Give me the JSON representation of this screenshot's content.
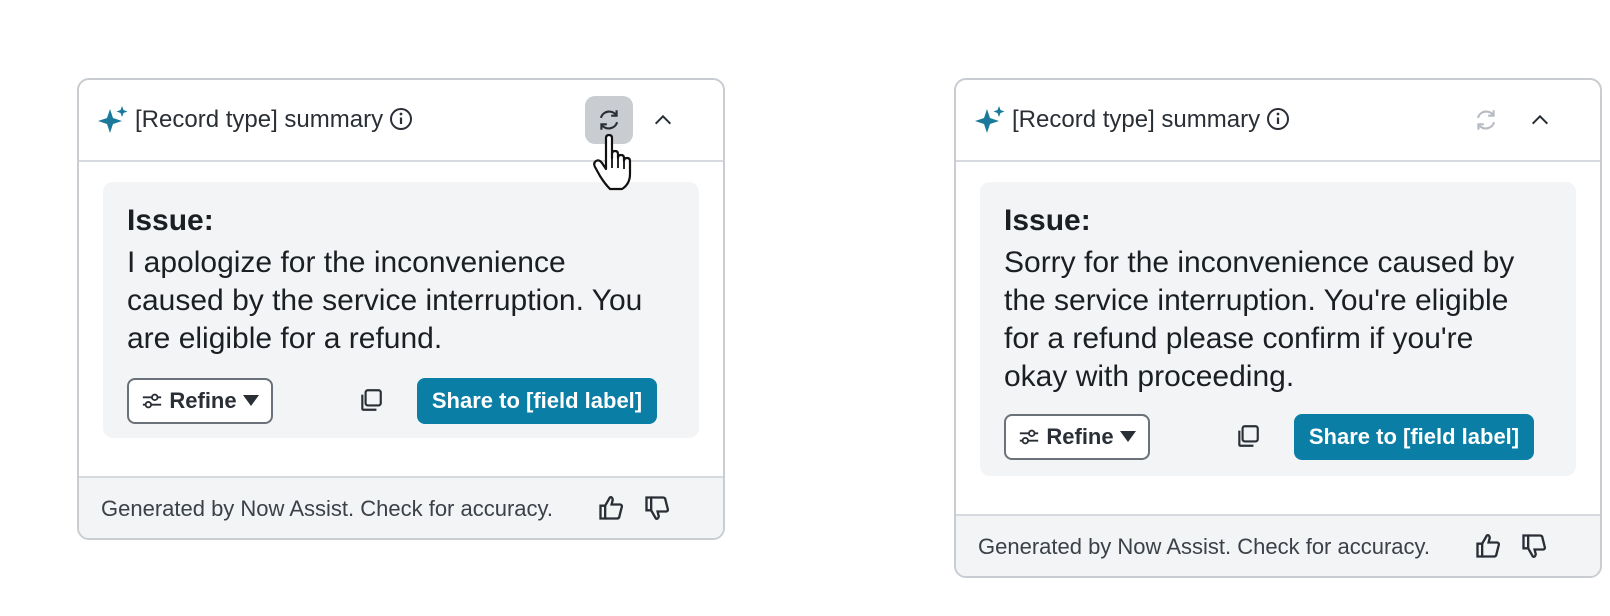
{
  "cards": [
    {
      "title": "[Record type] summary",
      "issue_label": "Issue:",
      "issue_text": "I apologize for the inconvenience caused by the service interruption. You are eligible for a refund.",
      "refine_label": "Refine",
      "share_label": "Share to [field label]",
      "footer_text": "Generated by Now Assist. Check for accuracy.",
      "refresh_state": "hover"
    },
    {
      "title": "[Record type] summary",
      "issue_label": "Issue:",
      "issue_text": "Sorry for the inconvenience caused by the service interruption. You're eligible for a refund please confirm if you're okay with proceeding.",
      "refine_label": "Refine",
      "share_label": "Share to [field label]",
      "footer_text": "Generated by Now Assist. Check for accuracy.",
      "refresh_state": "disabled"
    }
  ],
  "colors": {
    "accent": "#0a7ea4",
    "sparkle": "#1b7a9c",
    "hover_bg": "#c9cdd2",
    "panel_bg": "#f3f4f6"
  },
  "icons": [
    "sparkle-icon",
    "info-icon",
    "refresh-icon",
    "chevron-up-icon",
    "sliders-icon",
    "caret-down-icon",
    "copy-icon",
    "thumbs-up-icon",
    "thumbs-down-icon",
    "pointer-cursor"
  ]
}
